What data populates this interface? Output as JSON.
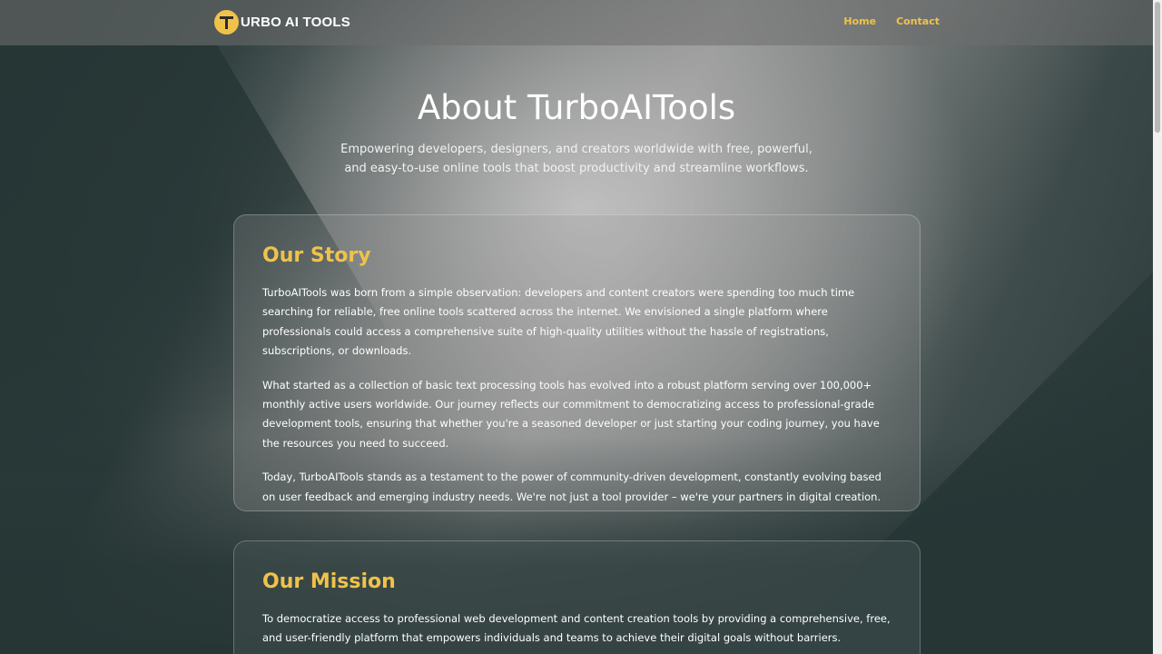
{
  "header": {
    "logo_text": "URBO AI TOOLS",
    "nav": [
      {
        "label": "Home"
      },
      {
        "label": "Contact"
      }
    ]
  },
  "hero": {
    "title": "About TurboAITools",
    "subtitle": "Empowering developers, designers, and creators worldwide with free, powerful, and easy-to-use online tools that boost productivity and streamline workflows."
  },
  "story": {
    "heading": "Our Story",
    "paragraphs": [
      "TurboAITools was born from a simple observation: developers and content creators were spending too much time searching for reliable, free online tools scattered across the internet. We envisioned a single platform where professionals could access a comprehensive suite of high-quality utilities without the hassle of registrations, subscriptions, or downloads.",
      "What started as a collection of basic text processing tools has evolved into a robust platform serving over 100,000+ monthly active users worldwide. Our journey reflects our commitment to democratizing access to professional-grade development tools, ensuring that whether you're a seasoned developer or just starting your coding journey, you have the resources you need to succeed.",
      "Today, TurboAITools stands as a testament to the power of community-driven development, constantly evolving based on user feedback and emerging industry needs. We're not just a tool provider – we're your partners in digital creation."
    ]
  },
  "mission": {
    "heading": "Our Mission",
    "paragraphs": [
      "To democratize access to professional web development and content creation tools by providing a comprehensive, free, and user-friendly platform that empowers individuals and teams to achieve their digital goals without barriers."
    ]
  },
  "colors": {
    "accent": "#f0c24a",
    "background": "#263635"
  }
}
